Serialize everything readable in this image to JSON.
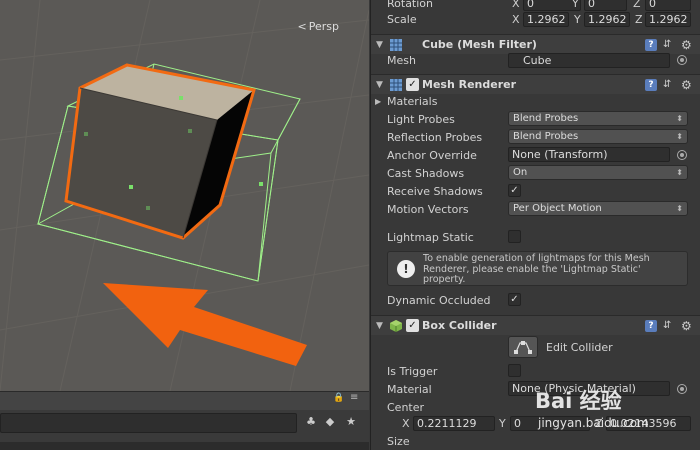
{
  "scene": {
    "projection_label": "Persp",
    "toolbar_icons": [
      "lock-icon",
      "menu-icon"
    ],
    "bottom_buttons": [
      "layers-icon",
      "tag-icon",
      "star-icon"
    ]
  },
  "inspector": {
    "rotation": {
      "label": "Rotation",
      "x": "0",
      "y": "0",
      "z": "0"
    },
    "scale": {
      "label": "Scale",
      "x": "1.2962",
      "y": "1.2962",
      "z": "1.2962"
    },
    "mesh_filter": {
      "title": "Cube (Mesh Filter)",
      "mesh_label": "Mesh",
      "mesh_value": "Cube"
    },
    "mesh_renderer": {
      "title": "Mesh Renderer",
      "enabled": true,
      "materials_label": "Materials",
      "light_probes_label": "Light Probes",
      "light_probes_value": "Blend Probes",
      "reflection_probes_label": "Reflection Probes",
      "reflection_probes_value": "Blend Probes",
      "anchor_override_label": "Anchor Override",
      "anchor_override_value": "None (Transform)",
      "cast_shadows_label": "Cast Shadows",
      "cast_shadows_value": "On",
      "receive_shadows_label": "Receive Shadows",
      "receive_shadows_checked": true,
      "motion_vectors_label": "Motion Vectors",
      "motion_vectors_value": "Per Object Motion",
      "lightmap_static_label": "Lightmap Static",
      "lightmap_static_checked": false,
      "help_text": "To enable generation of lightmaps for this Mesh Renderer, please enable the 'Lightmap Static' property.",
      "dynamic_occluded_label": "Dynamic Occluded",
      "dynamic_occluded_checked": true
    },
    "box_collider": {
      "title": "Box Collider",
      "enabled": true,
      "edit_collider_label": "Edit Collider",
      "is_trigger_label": "Is Trigger",
      "is_trigger_checked": false,
      "material_label": "Material",
      "material_value": "None (Physic Material)",
      "center_label": "Center",
      "center_x": "0.2211129",
      "center_y": "0",
      "center_z": "0.02143596",
      "size_label": "Size"
    },
    "axis_labels": {
      "x": "X",
      "y": "Y",
      "z": "Z"
    }
  },
  "watermark": {
    "text": "Bai 经验",
    "url": "jingyan.baidu.com"
  }
}
